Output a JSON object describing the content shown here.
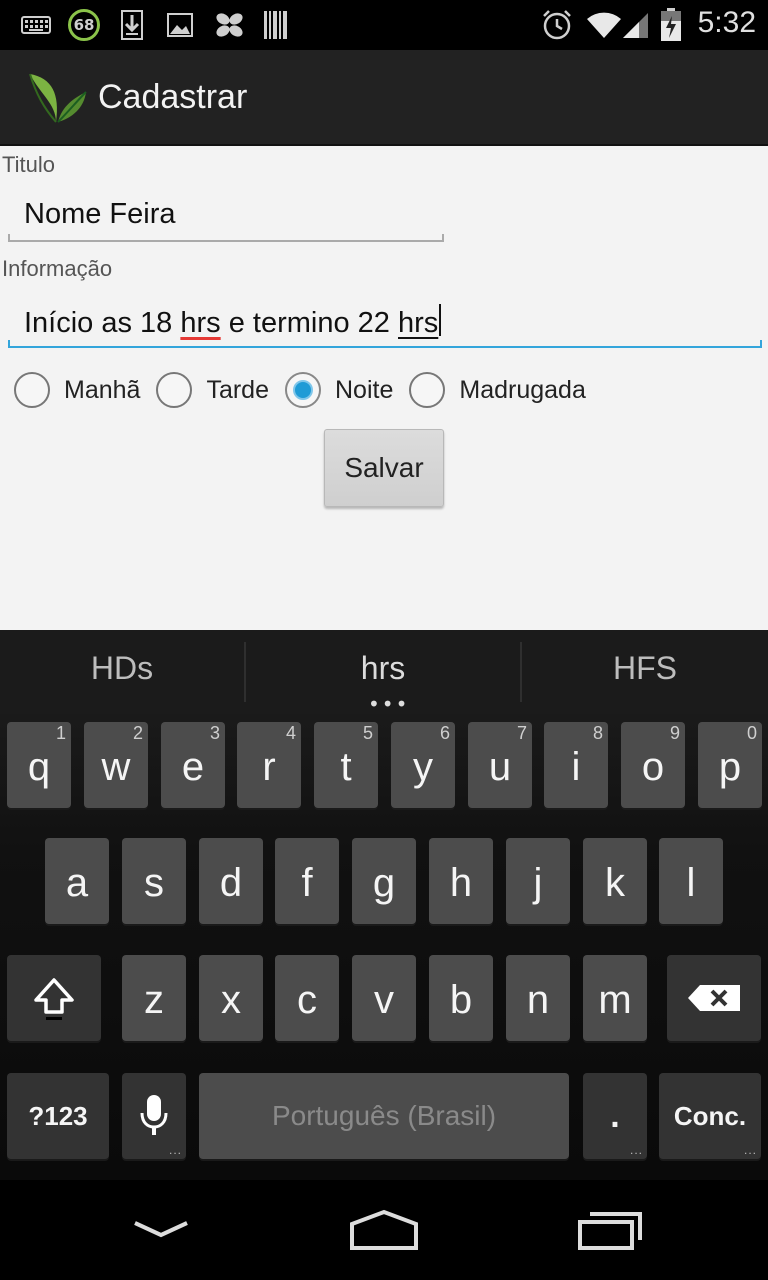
{
  "status_bar": {
    "time": "5:32",
    "battery_badge": "68",
    "icons": [
      "keyboard-icon",
      "battery-badge",
      "download-icon",
      "image-icon",
      "pinwheel-icon",
      "barcode-icon",
      "alarm-icon",
      "wifi-icon",
      "signal-icon",
      "battery-icon"
    ]
  },
  "action_bar": {
    "title": "Cadastrar",
    "logo": "leaf-logo-icon"
  },
  "form": {
    "titulo_label": "Titulo",
    "titulo_value": "Nome Feira",
    "info_label": "Informação",
    "info_value_part1": "Início as 18 ",
    "info_value_spell": "hrs",
    "info_value_part2": " e termino 22 ",
    "info_value_current": "hrs",
    "radios": [
      {
        "label": "Manhã",
        "checked": false
      },
      {
        "label": "Tarde",
        "checked": false
      },
      {
        "label": "Noite",
        "checked": true
      },
      {
        "label": "Madrugada",
        "checked": false
      }
    ],
    "save_label": "Salvar"
  },
  "keyboard": {
    "suggestions": [
      "HDs",
      "hrs",
      "HFS"
    ],
    "row1": [
      {
        "ch": "q",
        "num": "1"
      },
      {
        "ch": "w",
        "num": "2"
      },
      {
        "ch": "e",
        "num": "3"
      },
      {
        "ch": "r",
        "num": "4"
      },
      {
        "ch": "t",
        "num": "5"
      },
      {
        "ch": "y",
        "num": "6"
      },
      {
        "ch": "u",
        "num": "7"
      },
      {
        "ch": "i",
        "num": "8"
      },
      {
        "ch": "o",
        "num": "9"
      },
      {
        "ch": "p",
        "num": "0"
      }
    ],
    "row2": [
      "a",
      "s",
      "d",
      "f",
      "g",
      "h",
      "j",
      "k",
      "l"
    ],
    "row3": [
      "z",
      "x",
      "c",
      "v",
      "b",
      "n",
      "m"
    ],
    "symbols_label": "?123",
    "space_label": "Português (Brasil)",
    "period_label": ".",
    "done_label": "Conc.",
    "accent_color": "#33a5db"
  },
  "nav_bar": {
    "icons": [
      "back-chevron-icon",
      "home-icon",
      "recents-icon"
    ]
  }
}
